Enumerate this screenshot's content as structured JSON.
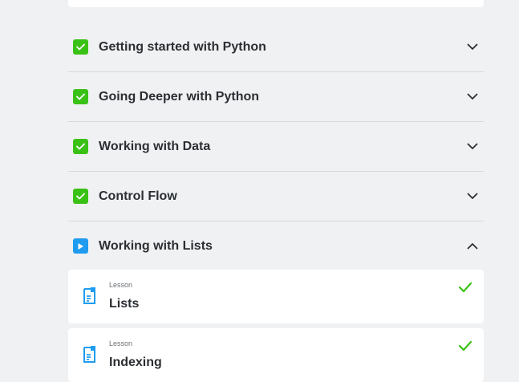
{
  "chapters": [
    {
      "title": "Getting started with Python",
      "status": "completed",
      "expanded": false
    },
    {
      "title": "Going Deeper with Python",
      "status": "completed",
      "expanded": false
    },
    {
      "title": "Working with Data",
      "status": "completed",
      "expanded": false
    },
    {
      "title": "Control Flow",
      "status": "completed",
      "expanded": false
    },
    {
      "title": "Working with Lists",
      "status": "in-progress",
      "expanded": true
    }
  ],
  "lessons": [
    {
      "type": "Lesson",
      "title": "Lists",
      "completed": true
    },
    {
      "type": "Lesson",
      "title": "Indexing",
      "completed": true
    }
  ],
  "colors": {
    "completed": "#3ac115",
    "in_progress": "#1f9cf0",
    "lesson_icon": "#1f9cf0",
    "check": "#3ac115"
  }
}
